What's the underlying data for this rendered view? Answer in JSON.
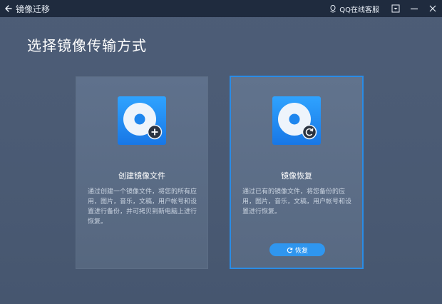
{
  "titlebar": {
    "title": "镜像迁移",
    "service": "QQ在线客服"
  },
  "main": {
    "heading": "选择镜像传输方式"
  },
  "cards": [
    {
      "title": "创建镜像文件",
      "desc": "通过创建一个镜像文件，将您的所有应用，图片，音乐，文稿，用户帐号和设置进行备份，并可拷贝到新电脑上进行恢复。",
      "icon": "disc-add-icon"
    },
    {
      "title": "镜像恢复",
      "desc": "通过已有的镜像文件，将您备份的应用，图片，音乐，文稿，用户帐号和设置进行恢复。",
      "icon": "disc-restore-icon",
      "button_label": "恢复"
    }
  ],
  "colors": {
    "accent": "#2f96ef",
    "titlebar": "#1f2b3e",
    "background": "#4a5a73"
  }
}
